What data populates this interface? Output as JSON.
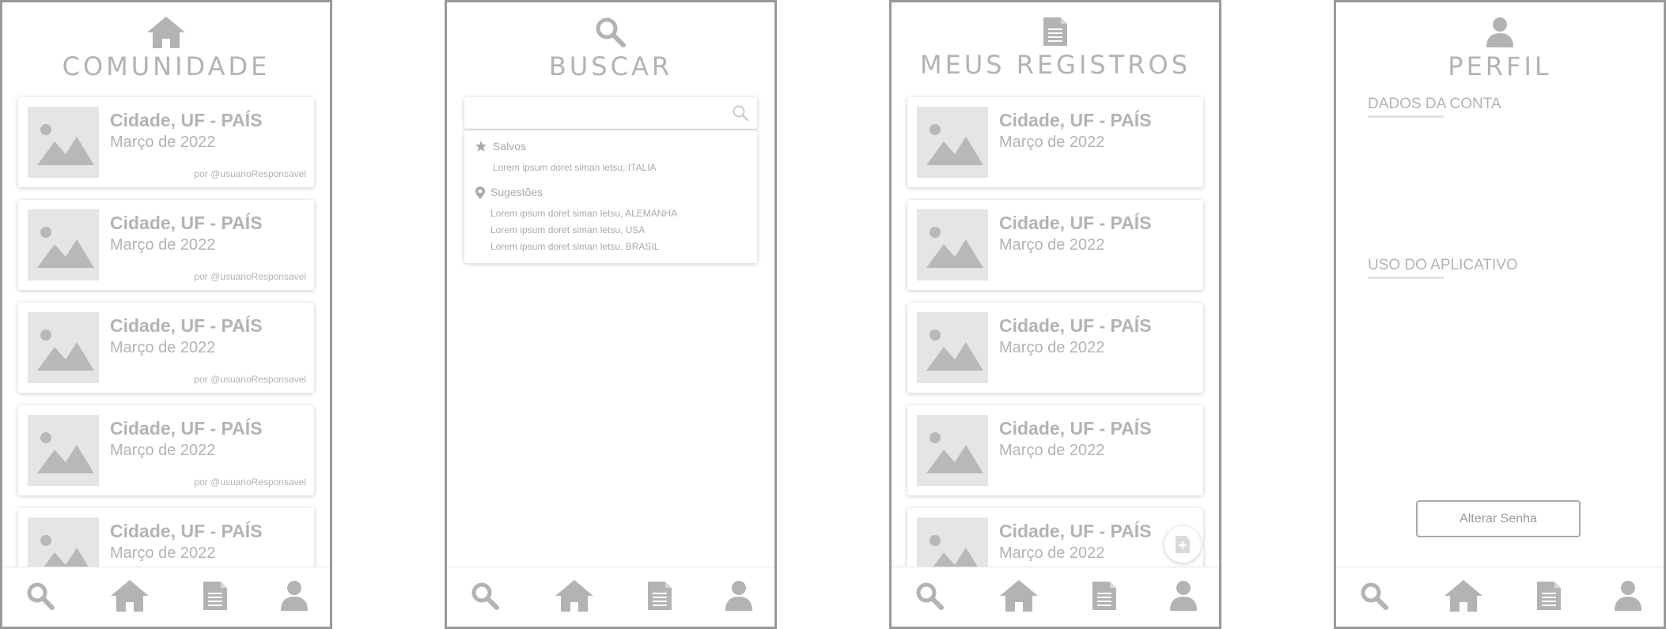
{
  "screens": {
    "comunidade": {
      "title": "COMUNIDADE",
      "header_icon": "home-icon",
      "cards": [
        {
          "place": "Cidade, UF - PAÍS",
          "date": "Março de 2022",
          "author": "por @usuarioResponsavel"
        },
        {
          "place": "Cidade, UF - PAÍS",
          "date": "Março de 2022",
          "author": "por @usuarioResponsavel"
        },
        {
          "place": "Cidade, UF - PAÍS",
          "date": "Março de 2022",
          "author": "por @usuarioResponsavel"
        },
        {
          "place": "Cidade, UF - PAÍS",
          "date": "Março de 2022",
          "author": "por @usuarioResponsavel"
        },
        {
          "place": "Cidade, UF - PAÍS",
          "date": "Março de 2022",
          "author": ""
        }
      ]
    },
    "buscar": {
      "title": "BUSCAR",
      "header_icon": "search-icon",
      "search_value": "",
      "saved_label": "Salvos",
      "saved_items": [
        "Lorem ipsum doret siman letsu, ITALIA"
      ],
      "suggestions_label": "Sugestões",
      "suggestions": [
        "Lorem ipsum doret siman letsu, ALEMANHA",
        "Lorem ipsum doret siman letsu, USA",
        "Lorem ipsum doret siman letsu, BRASIL"
      ]
    },
    "registros": {
      "title": "MEUS REGISTROS",
      "header_icon": "document-icon",
      "cards": [
        {
          "place": "Cidade, UF - PAÍS",
          "date": "Março de 2022"
        },
        {
          "place": "Cidade, UF - PAÍS",
          "date": "Março de 2022"
        },
        {
          "place": "Cidade, UF - PAÍS",
          "date": "Março de 2022"
        },
        {
          "place": "Cidade, UF - PAÍS",
          "date": "Março de 2022"
        },
        {
          "place": "Cidade, UF - PAÍS",
          "date": "Março de 2022"
        }
      ],
      "fab_icon": "add-document-icon"
    },
    "perfil": {
      "title": "PERFIL",
      "header_icon": "user-icon",
      "account_section": "DADOS DA CONTA",
      "usage_section": "USO DO APLICATIVO",
      "change_password_label": "Alterar Senha"
    }
  },
  "bottom_nav": [
    "search-icon",
    "home-icon",
    "document-icon",
    "user-icon"
  ],
  "colors": {
    "wireframe_gray": "#b3b3b3",
    "frame_border": "#999999",
    "placeholder_bg": "#e5e5e5"
  }
}
